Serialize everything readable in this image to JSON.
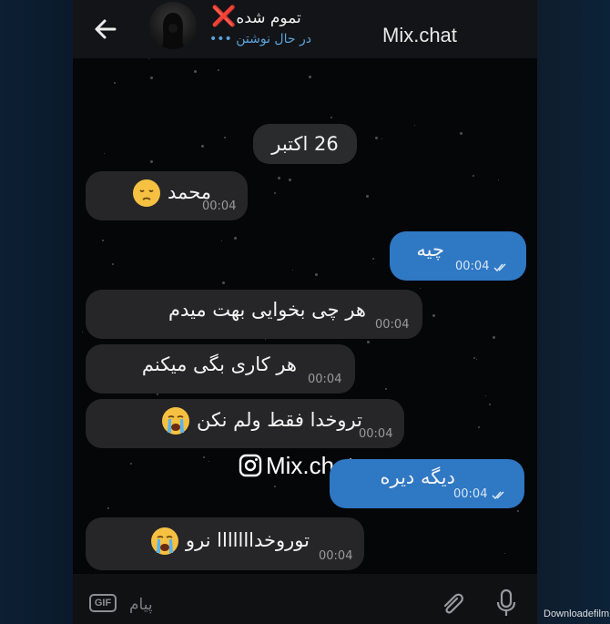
{
  "header": {
    "contact_name": "تموم شده",
    "contact_name_suffix": "❌",
    "status": "در حال نوشتن",
    "status_dots": "•••",
    "watermark": "Mix.chat"
  },
  "chat": {
    "date_label": "26 اکتبر",
    "messages": [
      {
        "direction": "in",
        "text": "محمد",
        "emoji": "pensive-face",
        "time": "00:04"
      },
      {
        "direction": "out",
        "text": "چیه",
        "time": "00:04",
        "read": true
      },
      {
        "direction": "in",
        "text": "هر چی بخوایی بهت میدم",
        "time": "00:04"
      },
      {
        "direction": "in",
        "text": "هر کاری بگی میکنم",
        "time": "00:04"
      },
      {
        "direction": "in",
        "text": "تروخدا فقط ولم نکن",
        "emoji": "crying-face",
        "time": "00:04"
      },
      {
        "direction": "out",
        "text": "دیگه دیره",
        "time": "00:04",
        "read": true
      },
      {
        "direction": "in",
        "text": "توروخدااااااا نرو",
        "emoji": "crying-face",
        "time": "00:04"
      }
    ],
    "watermark": "Mix.chat"
  },
  "input_bar": {
    "gif_label": "GIF",
    "placeholder": "پیام"
  },
  "site_watermark": "Downloadefilm.ir",
  "colors": {
    "outgoing_bubble": "#2f78c4",
    "incoming_bubble": "#262628",
    "header_bg": "#131417",
    "typing_status": "#5ba3dd",
    "x_mark": "#e5231c"
  }
}
